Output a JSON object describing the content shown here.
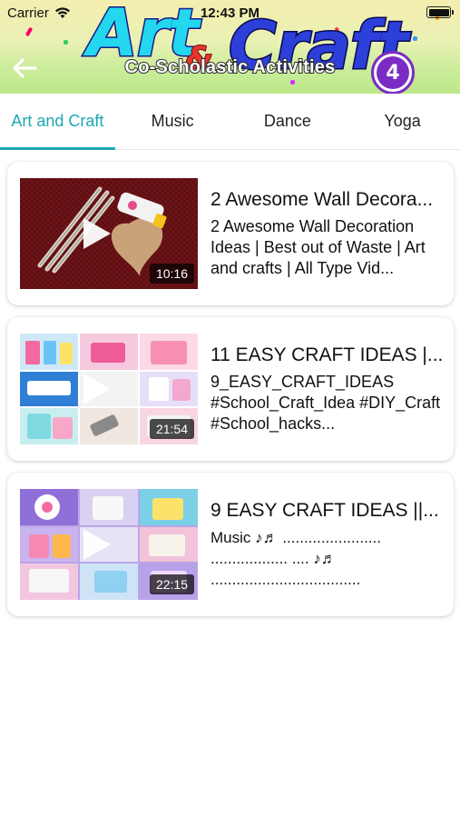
{
  "status_bar": {
    "carrier": "Carrier",
    "time": "12:43 PM"
  },
  "header": {
    "logo_art": "Art",
    "logo_amp": "&",
    "logo_craft": "Craft",
    "subtitle": "Co-Scholastic Activities",
    "badge": "4"
  },
  "tabs": [
    {
      "label": "Art and Craft",
      "active": true
    },
    {
      "label": "Music",
      "active": false
    },
    {
      "label": "Dance",
      "active": false
    },
    {
      "label": "Yoga",
      "active": false
    }
  ],
  "videos": [
    {
      "title": "2 Awesome Wall Decora...",
      "description": "2 Awesome Wall Decoration Ideas | Best out of Waste | Art and crafts | All Type Vid...",
      "duration": "10:16"
    },
    {
      "title": "11 EASY CRAFT IDEAS |...",
      "description": "9_EASY_CRAFT_IDEAS #School_Craft_Idea #DIY_Craft #School_hacks...",
      "duration": "21:54"
    },
    {
      "title": "9 EASY CRAFT IDEAS ||...",
      "description": "Music ♪♬ ....................... .................. .... ♪♬ ...................................",
      "duration": "22:15"
    }
  ],
  "colors": {
    "accent": "#1ea8b3",
    "badge": "#7b2bc4"
  }
}
